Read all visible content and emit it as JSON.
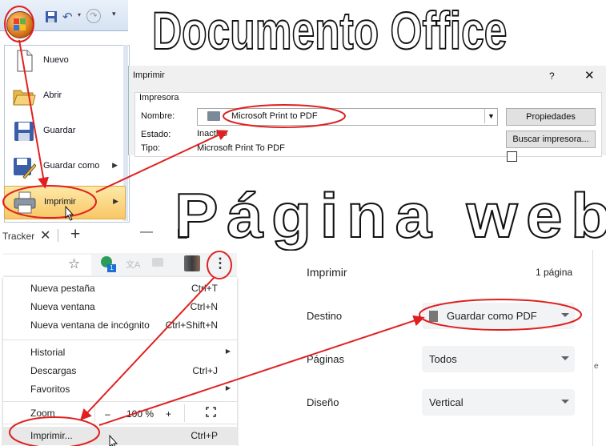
{
  "titles": {
    "office": "Documento Office",
    "web": "Página web"
  },
  "office": {
    "menu": [
      {
        "label": "Nuevo",
        "icon": "new-document-icon"
      },
      {
        "label": "Abrir",
        "icon": "open-folder-icon"
      },
      {
        "label": "Guardar",
        "icon": "save-disk-icon"
      },
      {
        "label": "Guardar como",
        "icon": "save-as-icon"
      },
      {
        "label": "Imprimir",
        "icon": "printer-icon"
      }
    ],
    "dialog": {
      "title": "Imprimir",
      "help": "?",
      "close": "✕",
      "group": "Impresora",
      "name_label": "Nombre:",
      "printer": "Microsoft Print to PDF",
      "state_label": "Estado:",
      "state": "Inactivo",
      "type_label": "Tipo:",
      "type": "Microsoft Print To PDF",
      "properties_btn": "Propiedades",
      "find_btn": "Buscar impresora..."
    }
  },
  "chrome": {
    "tab_label": "Tracker",
    "menu": {
      "new_tab": {
        "label": "Nueva pestaña",
        "shortcut": "Ctrl+T"
      },
      "new_window": {
        "label": "Nueva ventana",
        "shortcut": "Ctrl+N"
      },
      "incognito": {
        "label": "Nueva ventana de incógnito",
        "shortcut": "Ctrl+Shift+N"
      },
      "history": {
        "label": "Historial"
      },
      "downloads": {
        "label": "Descargas",
        "shortcut": "Ctrl+J"
      },
      "bookmarks": {
        "label": "Favoritos"
      },
      "zoom": {
        "label": "Zoom",
        "minus": "–",
        "value": "100 %",
        "plus": "+"
      },
      "print": {
        "label": "Imprimir...",
        "shortcut": "Ctrl+P"
      }
    },
    "print_panel": {
      "title": "Imprimir",
      "pages_count": "1 página",
      "destination_label": "Destino",
      "destination": "Guardar como PDF",
      "pages_label": "Páginas",
      "pages": "Todos",
      "layout_label": "Diseño",
      "layout": "Vertical",
      "edge_text": "e"
    }
  },
  "colors": {
    "annotation_red": "#e02020",
    "office_highlight": "#f8c766"
  }
}
